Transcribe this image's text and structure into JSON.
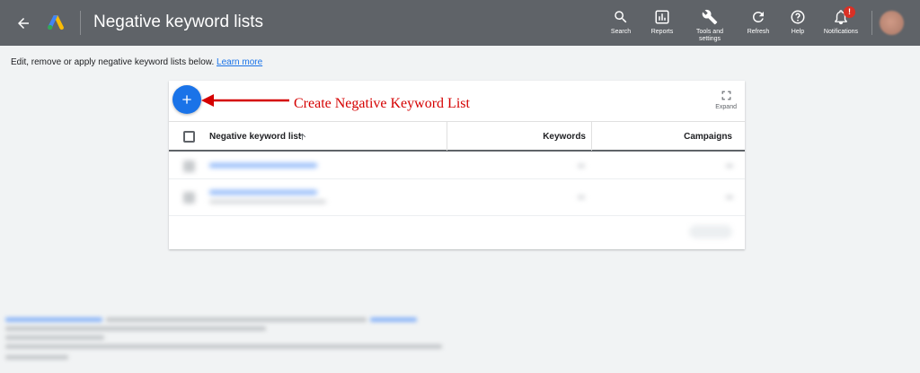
{
  "header": {
    "title": "Negative keyword lists",
    "tools": [
      {
        "label": "Search",
        "icon": "search-icon"
      },
      {
        "label": "Reports",
        "icon": "reports-icon"
      },
      {
        "label": "Tools and settings",
        "icon": "wrench-icon"
      },
      {
        "label": "Refresh",
        "icon": "refresh-icon"
      },
      {
        "label": "Help",
        "icon": "help-icon"
      },
      {
        "label": "Notifications",
        "icon": "bell-icon",
        "badge": "!"
      }
    ]
  },
  "intro": {
    "text": "Edit, remove or apply negative keyword lists below.",
    "link": "Learn more"
  },
  "card": {
    "expand_label": "Expand",
    "columns": {
      "name": "Negative keyword list",
      "keywords": "Keywords",
      "campaigns": "Campaigns"
    }
  },
  "annotation": {
    "text": "Create Negative Keyword List",
    "color": "#d50000"
  },
  "colors": {
    "topbar": "#5f6368",
    "accent": "#1a73e8",
    "background": "#f1f3f4"
  }
}
